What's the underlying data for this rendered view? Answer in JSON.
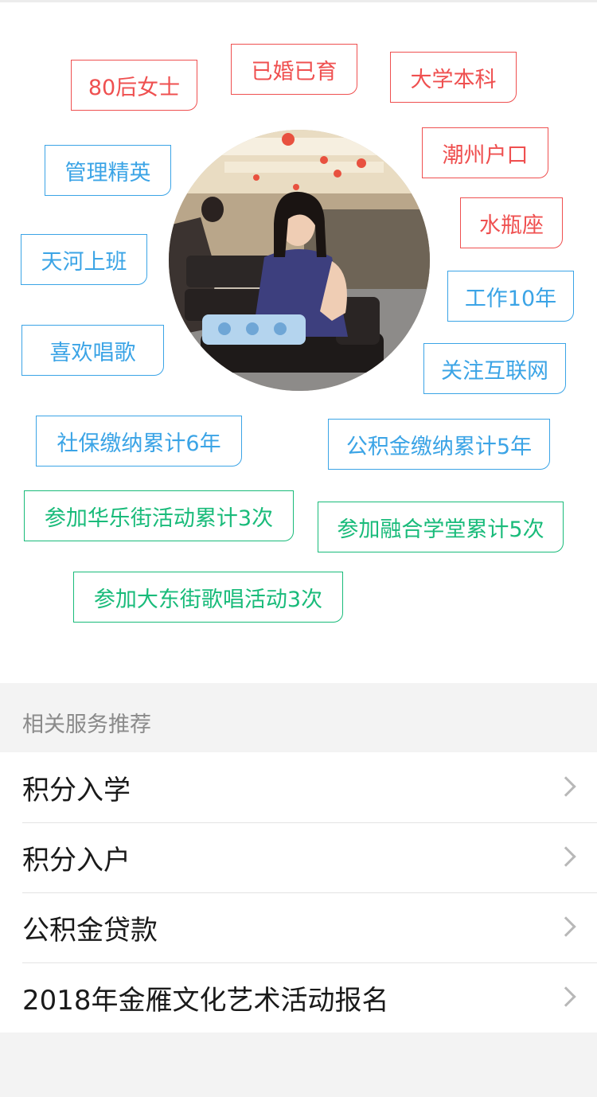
{
  "tags": {
    "t1": "80后女士",
    "t2": "已婚已育",
    "t3": "大学本科",
    "t4": "管理精英",
    "t5": "潮州户口",
    "t6": "水瓶座",
    "t7": "天河上班",
    "t8": "工作10年",
    "t9": "喜欢唱歌",
    "t10": "关注互联网",
    "t11": "社保缴纳累计6年",
    "t12": "公积金缴纳累计5年",
    "t13": "参加华乐街活动累计3次",
    "t14": "参加融合学堂累计5次",
    "t15": "参加大东街歌唱活动3次"
  },
  "colors": {
    "red": "#ef5050",
    "blue": "#3ba4e6",
    "green": "#19bb7a"
  },
  "services": {
    "title": "相关服务推荐",
    "items": [
      {
        "label": "积分入学"
      },
      {
        "label": "积分入户"
      },
      {
        "label": "公积金贷款"
      },
      {
        "label": "2018年金雁文化艺术活动报名"
      }
    ]
  }
}
